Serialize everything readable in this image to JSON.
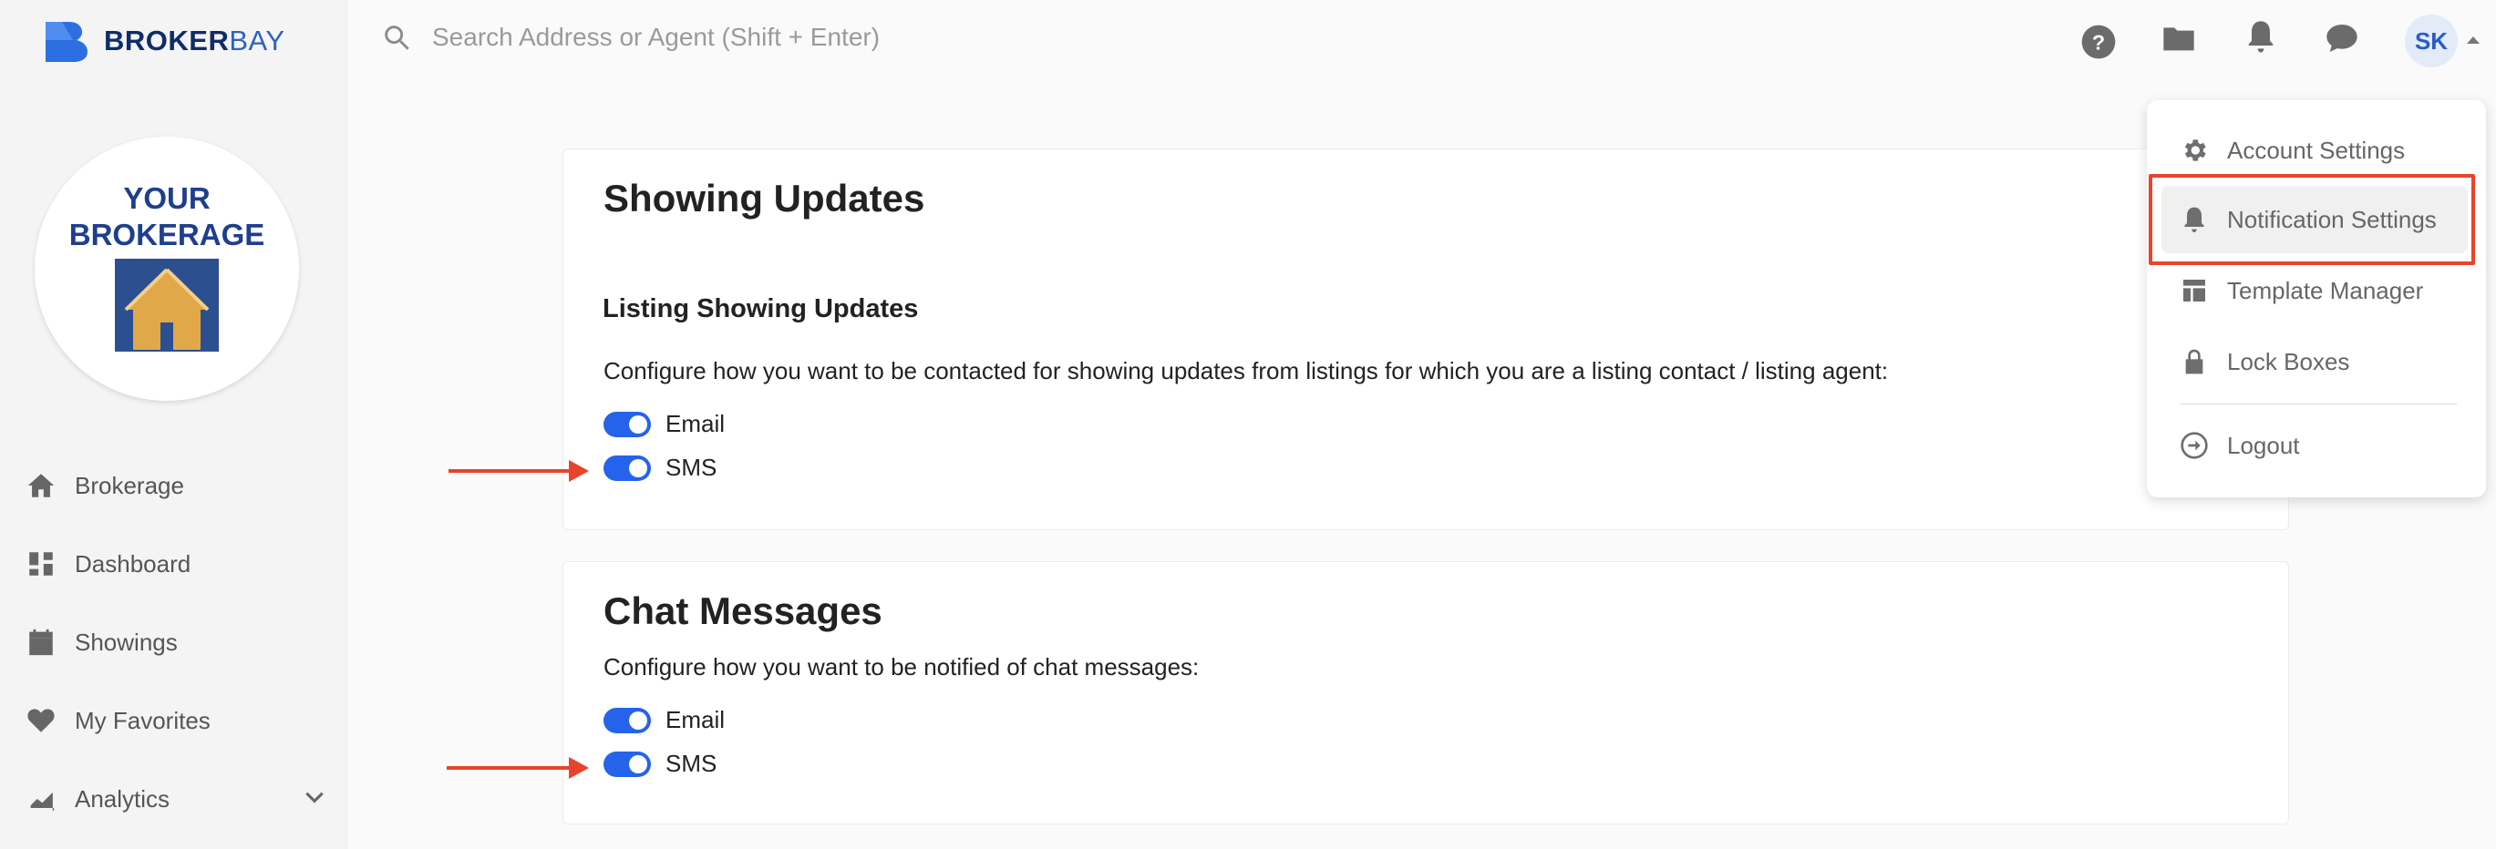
{
  "brand": {
    "logo_word1": "BROKER",
    "logo_word2": "BAY",
    "brokerage_line1": "YOUR",
    "brokerage_line2": "BROKERAGE"
  },
  "search": {
    "placeholder": "Search Address or Agent (Shift + Enter)"
  },
  "header": {
    "icons": [
      "help-icon",
      "folder-icon",
      "bell-icon",
      "chat-icon"
    ],
    "avatar_initials": "SK"
  },
  "sidebar": {
    "items": [
      {
        "label": "Brokerage",
        "icon": "home-icon"
      },
      {
        "label": "Dashboard",
        "icon": "dashboard-icon"
      },
      {
        "label": "Showings",
        "icon": "calendar-icon"
      },
      {
        "label": "My Favorites",
        "icon": "heart-icon"
      },
      {
        "label": "Analytics",
        "icon": "analytics-icon"
      }
    ]
  },
  "showing_updates": {
    "title": "Showing Updates",
    "subtitle": "Listing Showing Updates",
    "description": "Configure how you want to be contacted for showing updates from listings for which you are a listing contact / listing agent:",
    "options": [
      {
        "label": "Email",
        "enabled": true
      },
      {
        "label": "SMS",
        "enabled": true
      }
    ]
  },
  "chat_messages": {
    "title": "Chat Messages",
    "description": "Configure how you want to be notified of chat messages:",
    "options": [
      {
        "label": "Email",
        "enabled": true
      },
      {
        "label": "SMS",
        "enabled": true
      }
    ]
  },
  "account_menu": {
    "items": [
      {
        "label": "Account Settings",
        "icon": "gear-icon"
      },
      {
        "label": "Notification Settings",
        "icon": "bell-icon",
        "active": true
      },
      {
        "label": "Template Manager",
        "icon": "template-icon"
      },
      {
        "label": "Lock Boxes",
        "icon": "lock-icon"
      },
      {
        "label": "Logout",
        "icon": "logout-icon"
      }
    ]
  },
  "colors": {
    "accent": "#2563eb",
    "annotation": "#e8442b",
    "brand_dark": "#0f2d66",
    "brand_light": "#2d63b8"
  }
}
